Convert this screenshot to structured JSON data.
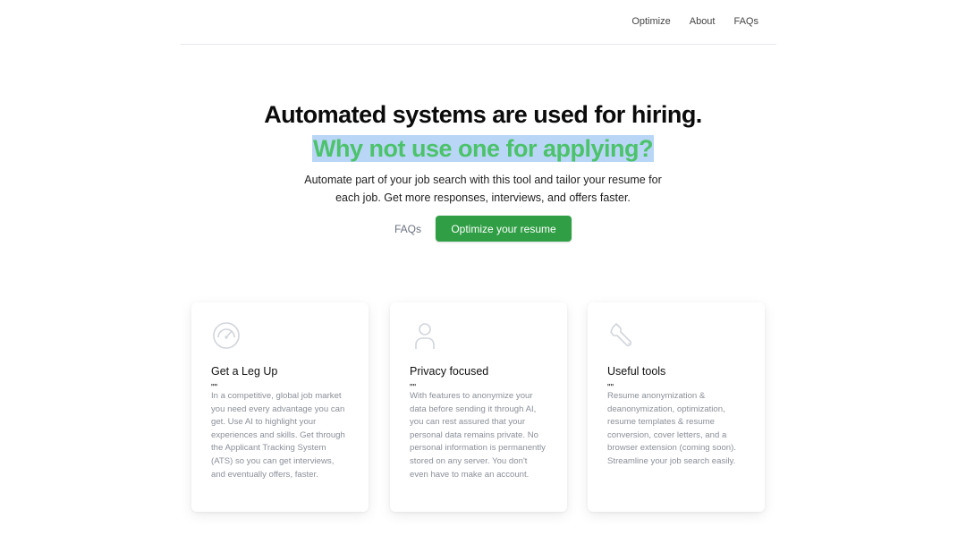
{
  "nav": {
    "items": [
      {
        "label": "Optimize"
      },
      {
        "label": "About"
      },
      {
        "label": "FAQs"
      }
    ]
  },
  "hero": {
    "title": "Automated systems are used for hiring.",
    "highlight": "Why not use one for applying?",
    "subtitle": "Automate part of your job search with this tool and tailor your resume for each job. Get more responses, interviews, and offers faster.",
    "faq_link": "FAQs",
    "cta": "Optimize your resume"
  },
  "colors": {
    "accent_green": "#2f9e44",
    "highlight_text": "#4cc26b",
    "selection_bg": "#b9d6f6"
  },
  "features": [
    {
      "icon": "speedometer-icon",
      "title": "Get a Leg Up",
      "quote": "\"\"",
      "body": "In a competitive, global job market you need every advantage you can get. Use AI to highlight your experiences and skills. Get through the Applicant Tracking System (ATS) so you can get interviews, and eventually offers, faster."
    },
    {
      "icon": "user-icon",
      "title": "Privacy focused",
      "quote": "\"\"",
      "body": "With features to anonymize your data before sending it through AI, you can rest assured that your personal data remains private. No personal information is permanently stored on any server. You don't even have to make an account."
    },
    {
      "icon": "wrench-icon",
      "title": "Useful tools",
      "quote": "\"\"",
      "body": "Resume anonymization & deanonymization, optimization, resume templates & resume conversion, cover letters, and a browser extension (coming soon). Streamline your job search easily."
    }
  ]
}
